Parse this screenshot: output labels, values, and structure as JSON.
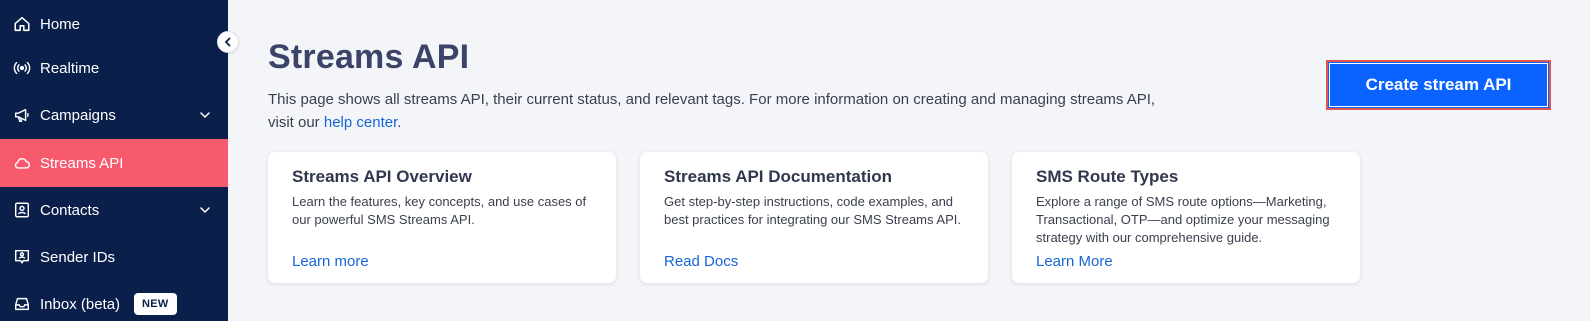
{
  "sidebar": {
    "items": [
      {
        "label": "Home",
        "icon": "home-icon"
      },
      {
        "label": "Realtime",
        "icon": "broadcast-icon"
      },
      {
        "label": "Campaigns",
        "icon": "megaphone-icon"
      },
      {
        "label": "Streams API",
        "icon": "cloud-icon",
        "active": true
      },
      {
        "label": "Contacts",
        "icon": "contacts-icon"
      },
      {
        "label": "Sender IDs",
        "icon": "sender-id-icon"
      },
      {
        "label": "Inbox (beta)",
        "icon": "inbox-icon",
        "badge": "NEW"
      }
    ]
  },
  "main": {
    "title": "Streams API",
    "description": "This page shows all streams API, their current status, and relevant tags. For more information on creating and managing streams API, visit our ",
    "help_link": "help center",
    "description_end": ".",
    "create_button": "Create stream API"
  },
  "cards": [
    {
      "title": "Streams API Overview",
      "description": "Learn the features, key concepts, and use cases of our powerful SMS Streams API.",
      "link": "Learn more"
    },
    {
      "title": "Streams API Documentation",
      "description": "Get step-by-step instructions, code examples, and best practices for integrating our SMS Streams API.",
      "link": "Read Docs"
    },
    {
      "title": "SMS Route Types",
      "description": "Explore a range of SMS route options—Marketing, Transactional, OTP—and optimize your messaging strategy with our comprehensive guide.",
      "link": "Learn More"
    }
  ],
  "colors": {
    "sidebar_bg": "#0b1f4b",
    "active_item": "#f85a6d",
    "primary_button": "#0a63ff",
    "link": "#1565d8",
    "page_bg": "#f4f5f9"
  }
}
